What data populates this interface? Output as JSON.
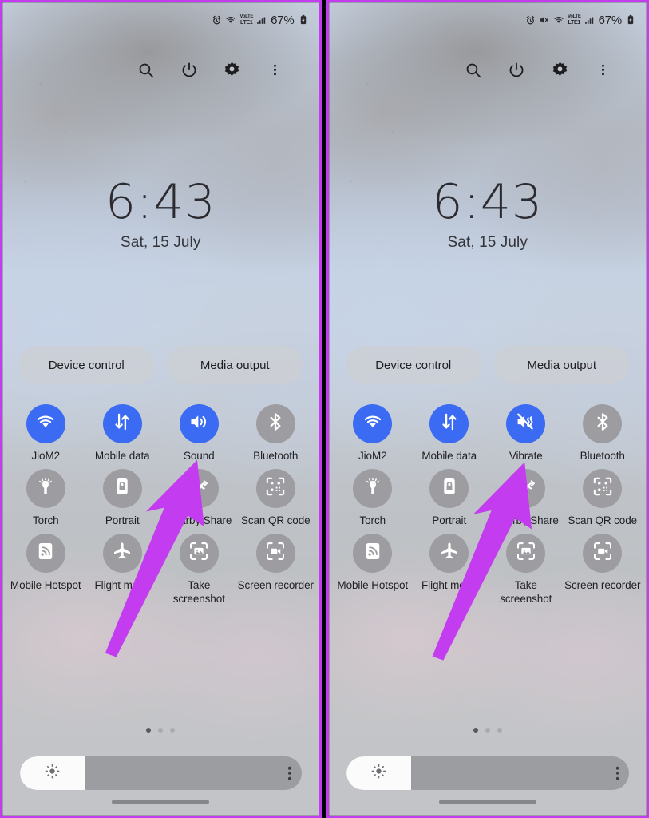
{
  "meta": {
    "accent_blue": "#3a6bf2",
    "inactive_gray": "#9d9da1",
    "arrow_purple": "#c43cf0",
    "border_purple": "#c43cf0"
  },
  "panels": [
    {
      "id": "left",
      "status_bar": {
        "icons": [
          "alarm-icon",
          "wifi-icon",
          "volte-icon",
          "signal-bars-icon"
        ],
        "volte_top": "VoLTE",
        "volte_bottom": "LTE1",
        "battery_percent": "67%",
        "battery_icon": "battery-icon",
        "mute_icon_visible": false
      },
      "header_actions": [
        {
          "name": "search-icon",
          "label": "Search"
        },
        {
          "name": "power-icon",
          "label": "Power"
        },
        {
          "name": "settings-gear-icon",
          "label": "Settings"
        },
        {
          "name": "overflow-menu-icon",
          "label": "More options"
        }
      ],
      "clock": {
        "time": "6:43",
        "date": "Sat, 15 July"
      },
      "pills": [
        {
          "label": "Device control"
        },
        {
          "label": "Media output"
        }
      ],
      "tiles": [
        {
          "label": "JioM2",
          "icon": "wifi-icon",
          "active": true
        },
        {
          "label": "Mobile data",
          "icon": "mobile-data-icon",
          "active": true
        },
        {
          "label": "Sound",
          "icon": "sound-on-icon",
          "active": true
        },
        {
          "label": "Bluetooth",
          "icon": "bluetooth-icon",
          "active": false
        },
        {
          "label": "Torch",
          "icon": "torch-icon",
          "active": false
        },
        {
          "label": "Portrait",
          "icon": "portrait-lock-icon",
          "active": false
        },
        {
          "label": "Nearby Share",
          "icon": "nearby-share-icon",
          "active": false
        },
        {
          "label": "Scan QR code",
          "icon": "qr-code-icon",
          "active": false
        },
        {
          "label": "Mobile Hotspot",
          "icon": "hotspot-icon",
          "active": false
        },
        {
          "label": "Flight mode",
          "icon": "airplane-icon",
          "active": false
        },
        {
          "label": "Take screenshot",
          "icon": "screenshot-icon",
          "active": false
        },
        {
          "label": "Screen recorder",
          "icon": "screen-record-icon",
          "active": false
        }
      ],
      "page_dots": {
        "count": 3,
        "active_index": 0
      },
      "brightness": {
        "percent": 23,
        "icon": "brightness-icon",
        "menu_icon": "overflow-menu-icon"
      },
      "annotation_arrow": {
        "color": "#c43cf0",
        "points_to": "Sound"
      }
    },
    {
      "id": "right",
      "status_bar": {
        "icons": [
          "alarm-icon",
          "mute-icon",
          "wifi-icon",
          "volte-icon",
          "signal-bars-icon"
        ],
        "volte_top": "VoLTE",
        "volte_bottom": "LTE1",
        "battery_percent": "67%",
        "battery_icon": "battery-icon",
        "mute_icon_visible": true
      },
      "header_actions": [
        {
          "name": "search-icon",
          "label": "Search"
        },
        {
          "name": "power-icon",
          "label": "Power"
        },
        {
          "name": "settings-gear-icon",
          "label": "Settings"
        },
        {
          "name": "overflow-menu-icon",
          "label": "More options"
        }
      ],
      "clock": {
        "time": "6:43",
        "date": "Sat, 15 July"
      },
      "pills": [
        {
          "label": "Device control"
        },
        {
          "label": "Media output"
        }
      ],
      "tiles": [
        {
          "label": "JioM2",
          "icon": "wifi-icon",
          "active": true
        },
        {
          "label": "Mobile data",
          "icon": "mobile-data-icon",
          "active": true
        },
        {
          "label": "Vibrate",
          "icon": "vibrate-icon",
          "active": true
        },
        {
          "label": "Bluetooth",
          "icon": "bluetooth-icon",
          "active": false
        },
        {
          "label": "Torch",
          "icon": "torch-icon",
          "active": false
        },
        {
          "label": "Portrait",
          "icon": "portrait-lock-icon",
          "active": false
        },
        {
          "label": "Nearby Share",
          "icon": "nearby-share-icon",
          "active": false
        },
        {
          "label": "Scan QR code",
          "icon": "qr-code-icon",
          "active": false
        },
        {
          "label": "Mobile Hotspot",
          "icon": "hotspot-icon",
          "active": false
        },
        {
          "label": "Flight mode",
          "icon": "airplane-icon",
          "active": false
        },
        {
          "label": "Take screenshot",
          "icon": "screenshot-icon",
          "active": false
        },
        {
          "label": "Screen recorder",
          "icon": "screen-record-icon",
          "active": false
        }
      ],
      "page_dots": {
        "count": 3,
        "active_index": 0
      },
      "brightness": {
        "percent": 23,
        "icon": "brightness-icon",
        "menu_icon": "overflow-menu-icon"
      },
      "annotation_arrow": {
        "color": "#c43cf0",
        "points_to": "Vibrate"
      }
    }
  ]
}
